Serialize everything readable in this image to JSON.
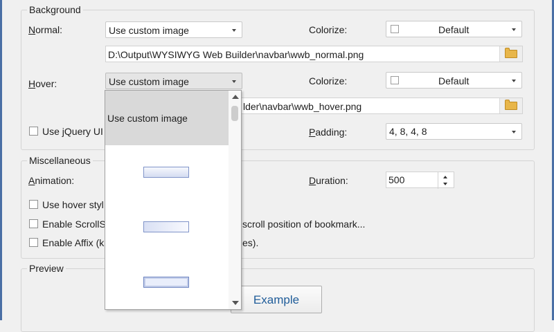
{
  "background": {
    "title": "Background",
    "normal_label": "Normal:",
    "normal_select": "Use custom image",
    "colorize_label": "Colorize:",
    "colorize_normal": "Default",
    "normal_path": "D:\\Output\\WYSIWYG Web Builder\\navbar\\wwb_normal.png",
    "hover_label": "Hover:",
    "hover_select": "Use custom image",
    "colorize_hover": "Default",
    "hover_path_visible": "lder\\navbar\\wwb_hover.png",
    "jquery_label": "Use jQuery UI",
    "padding_label": "Padding:",
    "padding_value": "4, 8, 4, 8"
  },
  "dropdown": {
    "items": [
      "Use custom image",
      "",
      "",
      ""
    ],
    "selected_index": 0
  },
  "misc": {
    "title": "Miscellaneous",
    "animation_label": "Animation:",
    "duration_label": "Duration:",
    "duration_value": "500",
    "hover_style_label": "Use hover styl",
    "scrollspy_label": "Enable ScrollS",
    "scrollspy_rest": "scroll position of bookmark...",
    "affix_label": "Enable Affix (k",
    "affix_rest": "es)."
  },
  "preview": {
    "title": "Preview",
    "example_label": "Example"
  },
  "colors": {
    "frame": "#4a6fa5",
    "selected_item": "#d9d9d9",
    "example_text": "#1f5c99"
  }
}
